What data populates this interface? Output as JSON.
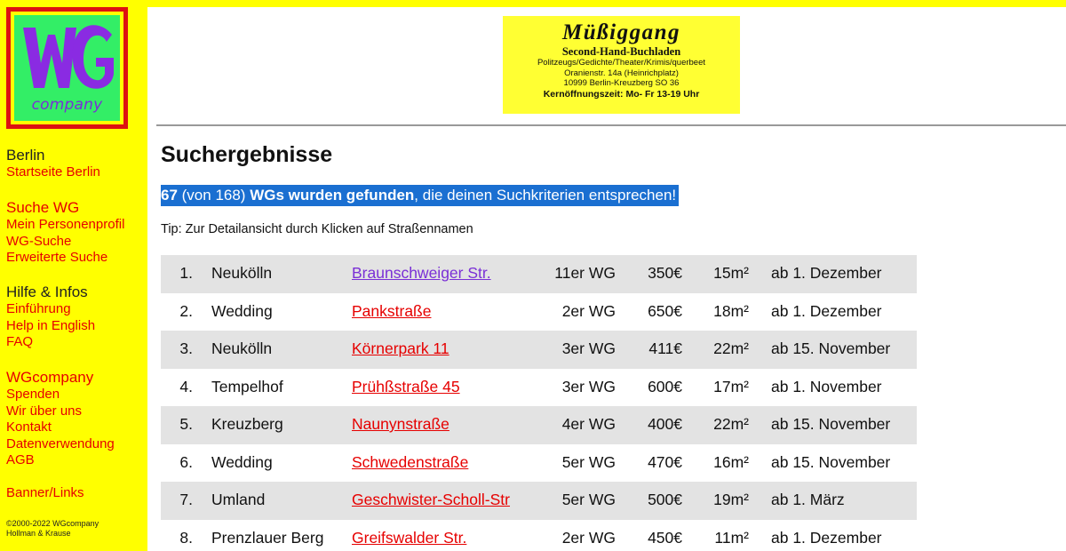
{
  "logo": {
    "wg_text": "WG",
    "company_text": "company"
  },
  "sidebar": {
    "groups": [
      {
        "heading": "Berlin",
        "links": [
          "Startseite Berlin"
        ]
      },
      {
        "heading": "Suche WG",
        "links": [
          "Mein Personenprofil",
          "WG-Suche",
          "Erweiterte Suche"
        ]
      },
      {
        "heading": "Hilfe & Infos",
        "links": [
          "Einführung",
          "Help in English",
          "FAQ"
        ]
      },
      {
        "heading": "WGcompany",
        "links": [
          "Spenden",
          "Wir über uns",
          "Kontakt",
          "Datenverwendung",
          "AGB"
        ]
      }
    ],
    "banner_links": "Banner/Links",
    "copyright_1": "©2000-2022 WGcompany",
    "copyright_2": "Hollman & Krause"
  },
  "banner": {
    "title": "Müßiggang",
    "subtitle": "Second-Hand-Buchladen",
    "line1": "Politzeugs/Gedichte/Theater/Krimis/querbeet",
    "line2": "Oranienstr. 14a (Heinrichplatz)",
    "line3": "10999 Berlin-Kreuzberg SO 36",
    "hours": "Kernöffnungszeit: Mo- Fr  13-19 Uhr"
  },
  "main": {
    "title": "Suchergebnisse",
    "result_count": "67",
    "result_total": " (von 168) ",
    "result_bold": "WGs wurden gefunden",
    "result_rest": ", die deinen Suchkriterien entsprechen!",
    "tip": "Tip: Zur Detailansicht durch Klicken auf Straßennamen"
  },
  "results": [
    {
      "num": "1.",
      "district": "Neukölln",
      "street": "Braunschweiger Str.",
      "visited": true,
      "type": "11er WG",
      "price": "350€",
      "size": "15m²",
      "date": "ab 1. Dezember"
    },
    {
      "num": "2.",
      "district": "Wedding",
      "street": "Pankstraße",
      "visited": false,
      "type": "2er WG",
      "price": "650€",
      "size": "18m²",
      "date": "ab 1. Dezember"
    },
    {
      "num": "3.",
      "district": "Neukölln",
      "street": "Körnerpark 11",
      "visited": false,
      "type": "3er WG",
      "price": "411€",
      "size": "22m²",
      "date": "ab 15. November"
    },
    {
      "num": "4.",
      "district": "Tempelhof",
      "street": "Prühßstraße 45",
      "visited": false,
      "type": "3er WG",
      "price": "600€",
      "size": "17m²",
      "date": "ab 1. November"
    },
    {
      "num": "5.",
      "district": "Kreuzberg",
      "street": "Naunynstraße",
      "visited": false,
      "type": "4er WG",
      "price": "400€",
      "size": "22m²",
      "date": "ab 15. November"
    },
    {
      "num": "6.",
      "district": "Wedding",
      "street": "Schwedenstraße",
      "visited": false,
      "type": "5er WG",
      "price": "470€",
      "size": "16m²",
      "date": "ab 15. November"
    },
    {
      "num": "7.",
      "district": "Umland",
      "street": "Geschwister-Scholl-Str",
      "visited": false,
      "type": "5er WG",
      "price": "500€",
      "size": "19m²",
      "date": "ab 1. März"
    },
    {
      "num": "8.",
      "district": "Prenzlauer Berg",
      "street": "Greifswalder Str.",
      "visited": false,
      "type": "2er WG",
      "price": "450€",
      "size": "11m²",
      "date": "ab 1. Dezember"
    }
  ],
  "colors": {
    "sidebar_bg": "#ffff00",
    "link": "#e60000",
    "visited_link": "#7a2fd6",
    "highlight": "#1a6fd1",
    "row_shade": "#e3e3e3"
  }
}
